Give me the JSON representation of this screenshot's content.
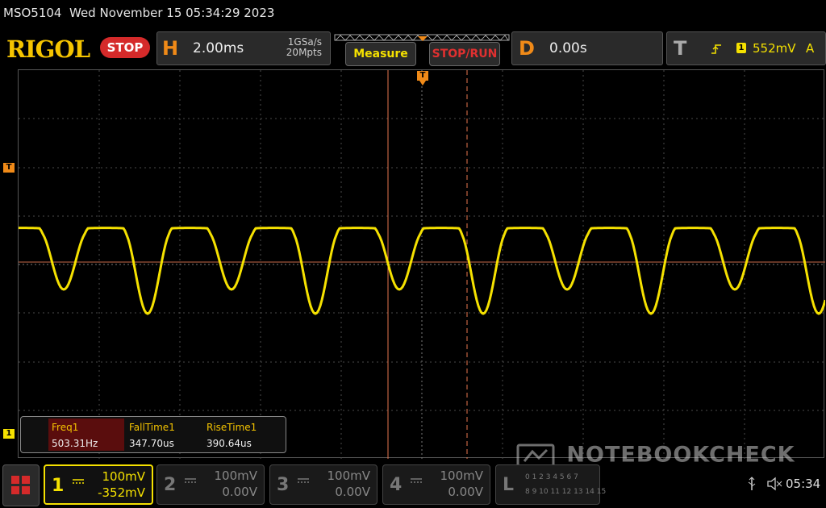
{
  "title": {
    "model": "MSO5104",
    "datetime": "Wed November 15 05:34:29 2023"
  },
  "toolbar": {
    "logo": "RIGOL",
    "run_state": "STOP",
    "horizontal": {
      "letter": "H",
      "timebase": "2.00ms",
      "sample_rate": "1GSa/s",
      "memory_depth": "20Mpts"
    },
    "measure_button": "Measure",
    "stop_run_button": "STOP/RUN",
    "delay": {
      "letter": "D",
      "value": "0.00s"
    },
    "trigger": {
      "letter": "T",
      "source_badge": "1",
      "level": "552mV",
      "mode": "A"
    }
  },
  "markers": {
    "trigger_top": "T",
    "trigger_left": "T",
    "ch1_left": "1"
  },
  "measurements": {
    "items": [
      {
        "label": "Freq1",
        "value": "503.31Hz"
      },
      {
        "label": "FallTime1",
        "value": "347.70us"
      },
      {
        "label": "RiseTime1",
        "value": "390.64us"
      }
    ]
  },
  "channels": [
    {
      "num": "1",
      "scale": "100mV",
      "offset": "-352mV",
      "active": true
    },
    {
      "num": "2",
      "scale": "100mV",
      "offset": "0.00V",
      "active": false
    },
    {
      "num": "3",
      "scale": "100mV",
      "offset": "0.00V",
      "active": false
    },
    {
      "num": "4",
      "scale": "100mV",
      "offset": "0.00V",
      "active": false
    }
  ],
  "logic": {
    "letter": "L",
    "row1": "0 1 2 3 4 5 6 7",
    "row2": "8 9 10 11 12 13 14 15"
  },
  "status": {
    "time": "05:34"
  },
  "watermark": "NOTEBOOKCHECK",
  "colors": {
    "ch1": "#f5e100",
    "trigger": "#f08a18",
    "stop": "#d52a2a"
  }
}
